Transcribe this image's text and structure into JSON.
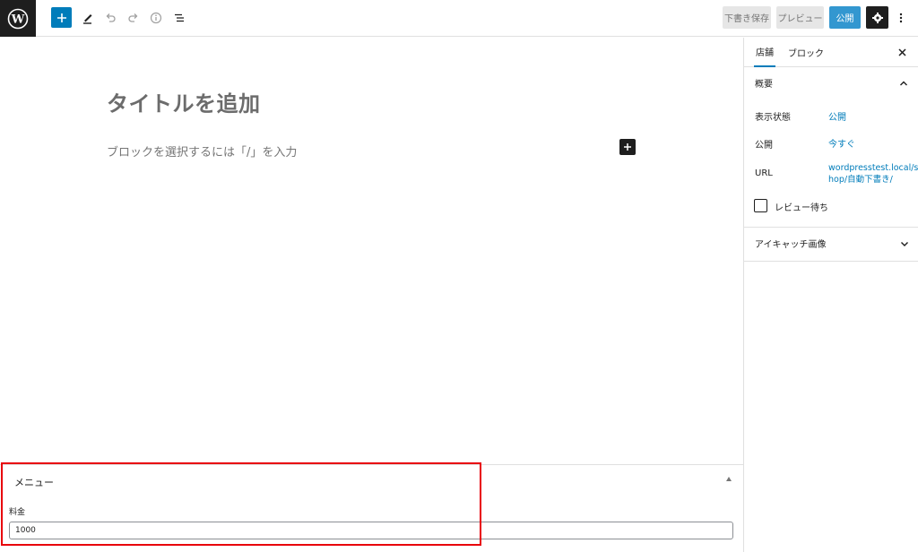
{
  "toolbar": {
    "save_draft_label": "下書き保存",
    "preview_label": "プレビュー",
    "publish_label": "公開"
  },
  "editor": {
    "title_placeholder": "タイトルを追加",
    "block_placeholder": "ブロックを選択するには「/」を入力"
  },
  "sidebar": {
    "tabs": [
      {
        "label": "店舗",
        "active": true
      },
      {
        "label": "ブロック",
        "active": false
      }
    ],
    "summary": {
      "heading": "概要",
      "rows": [
        {
          "label": "表示状態",
          "value": "公開"
        },
        {
          "label": "公開",
          "value": "今すぐ"
        },
        {
          "label": "URL",
          "value_line1": "wordpresstest.local/s",
          "value_line2": "hop/自動下書き/"
        }
      ],
      "pending_review_label": "レビュー待ち"
    },
    "featured_image_heading": "アイキャッチ画像"
  },
  "metabox": {
    "title": "メニュー",
    "field_label": "料金",
    "field_value": "1000"
  },
  "colors": {
    "accent": "#007cba",
    "highlight_border": "#e8000b",
    "dark": "#1e1e1e"
  }
}
